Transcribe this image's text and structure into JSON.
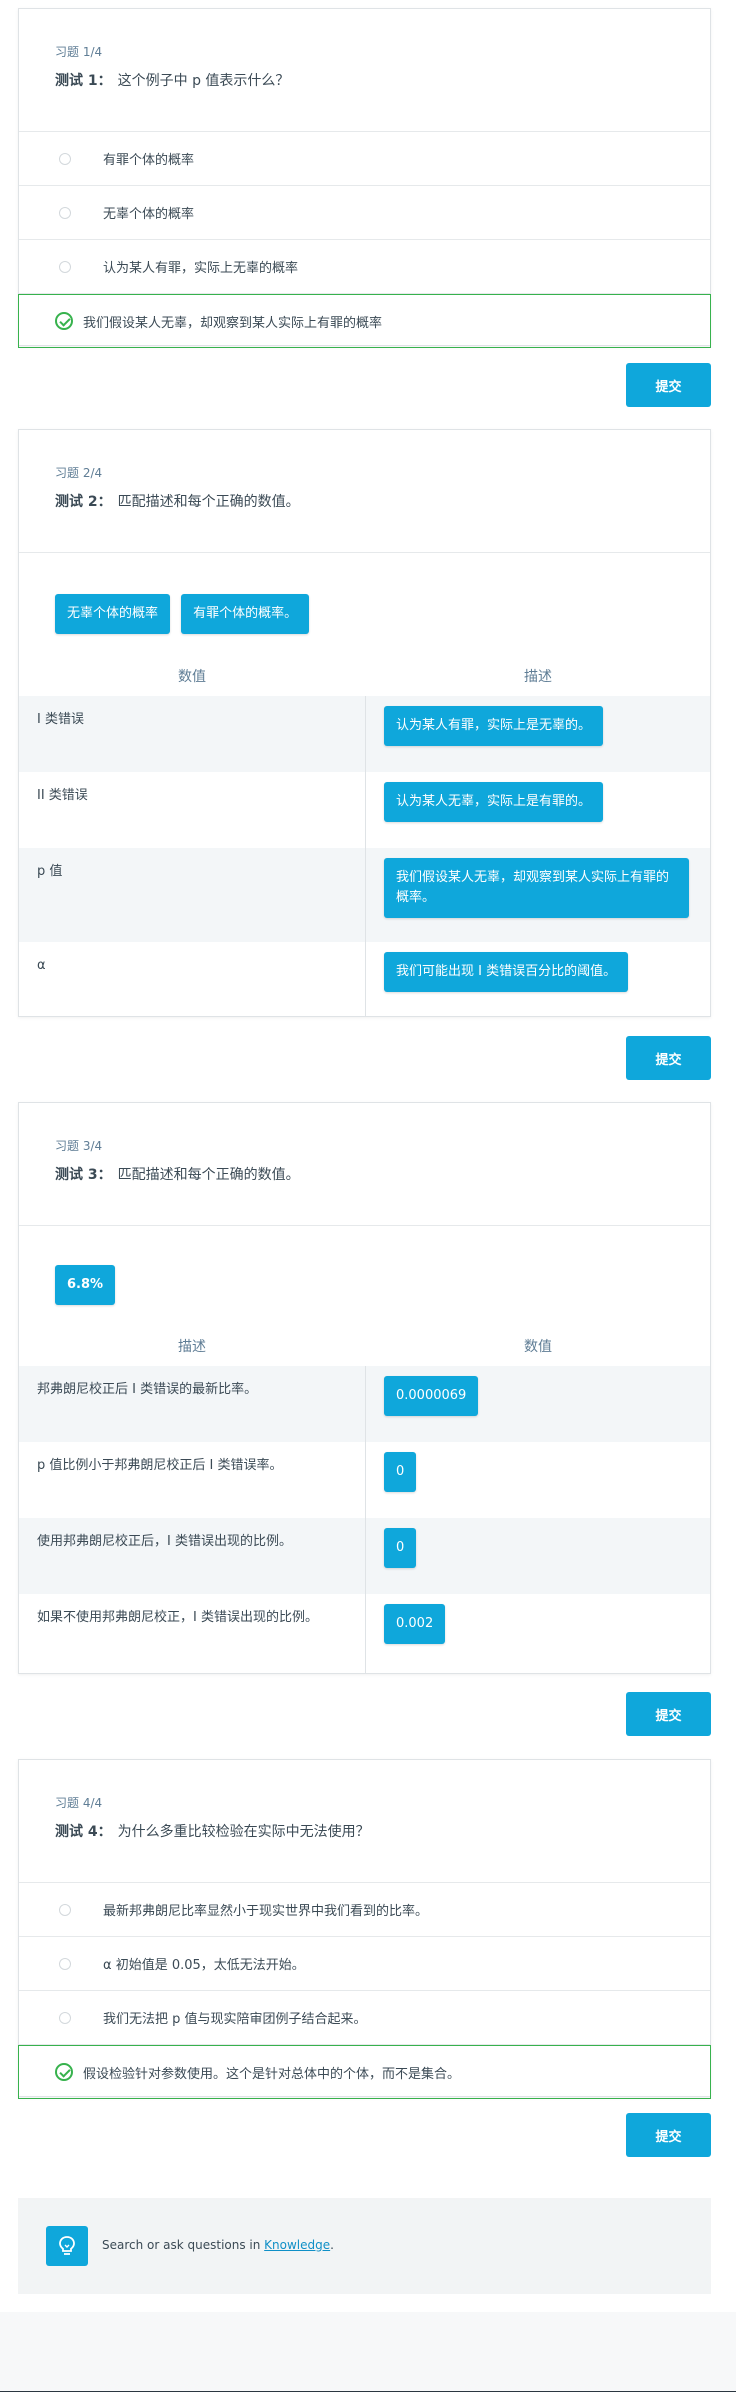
{
  "q1": {
    "exercise": "习题 1/4",
    "label": "测试 1：",
    "question": "这个例子中 p 值表示什么？",
    "options": [
      "有罪个体的概率",
      "无辜个体的概率",
      "认为某人有罪，实际上无辜的概率",
      "我们假设某人无辜，却观察到某人实际上有罪的概率"
    ],
    "submit": "提交"
  },
  "q2": {
    "exercise": "习题 2/4",
    "label": "测试 2：",
    "question": "匹配描述和每个正确的数值。",
    "pool": [
      "无辜个体的概率",
      "有罪个体的概率。"
    ],
    "col_left": "数值",
    "col_right": "描述",
    "rows": [
      {
        "left": "I 类错误",
        "right": "认为某人有罪，实际上是无辜的。"
      },
      {
        "left": "II 类错误",
        "right": "认为某人无辜，实际上是有罪的。"
      },
      {
        "left": "p 值",
        "right": "我们假设某人无辜，却观察到某人实际上有罪的概率。"
      },
      {
        "left": "α",
        "right": "我们可能出现 I 类错误百分比的阈值。"
      }
    ],
    "submit": "提交"
  },
  "q3": {
    "exercise": "习题 3/4",
    "label": "测试 3：",
    "question": "匹配描述和每个正确的数值。",
    "pool": [
      "6.8%"
    ],
    "col_left": "描述",
    "col_right": "数值",
    "rows": [
      {
        "left": "邦弗朗尼校正后 I 类错误的最新比率。",
        "right": "0.0000069"
      },
      {
        "left": "p 值比例小于邦弗朗尼校正后 I 类错误率。",
        "right": "0"
      },
      {
        "left": "使用邦弗朗尼校正后，I 类错误出现的比例。",
        "right": "0"
      },
      {
        "left": "如果不使用邦弗朗尼校正，I 类错误出现的比例。",
        "right": "0.002"
      }
    ],
    "submit": "提交"
  },
  "q4": {
    "exercise": "习题 4/4",
    "label": "测试 4：",
    "question": "为什么多重比较检验在实际中无法使用？",
    "options": [
      "最新邦弗朗尼比率显然小于现实世界中我们看到的比率。",
      "α 初始值是 0.05，太低无法开始。",
      "我们无法把 p 值与现实陪审团例子结合起来。",
      "假设检验针对参数使用。这个是针对总体中的个体，而不是集合。"
    ],
    "submit": "提交"
  },
  "footer": {
    "prefix": "Search or ask questions in ",
    "link": "Knowledge",
    "suffix": ".",
    "icon": "lightbulb-icon"
  },
  "colors": {
    "accent": "#0fa7db",
    "correct": "#37b24d"
  }
}
